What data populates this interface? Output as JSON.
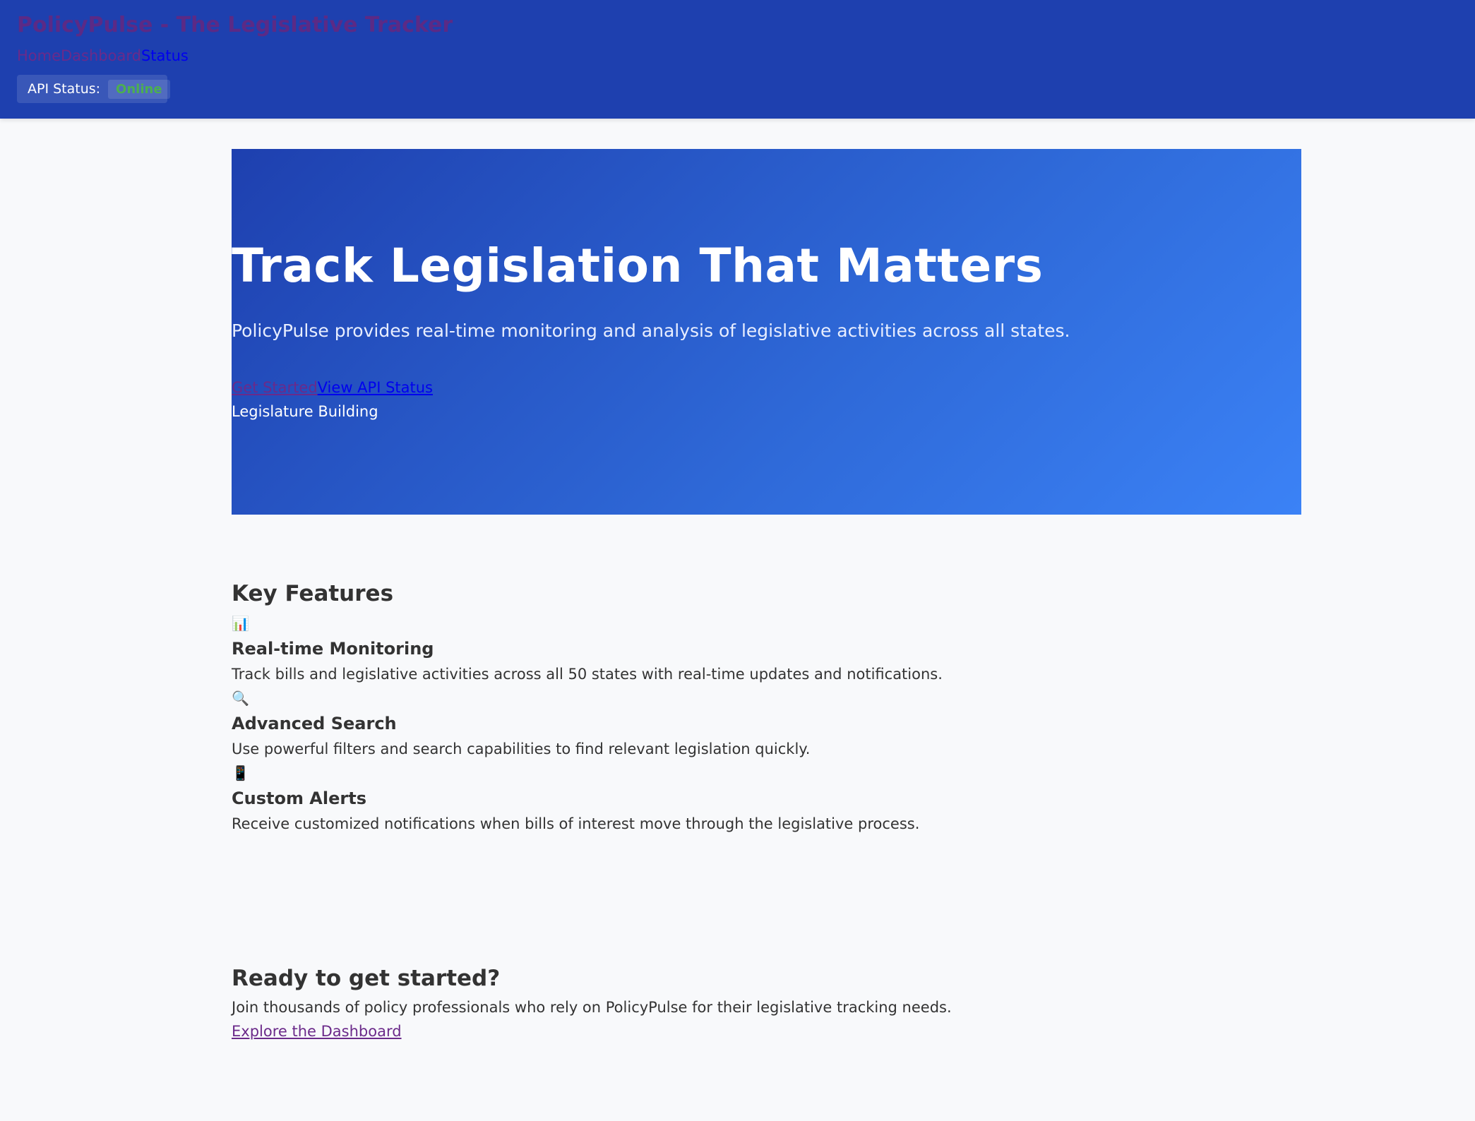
{
  "header": {
    "site_title": "PolicyPulse - The Legislative Tracker",
    "nav": {
      "home": "Home",
      "dashboard": "Dashboard",
      "status": "Status"
    },
    "api_status": {
      "label": "API Status:",
      "value": "Online",
      "value_color": "#4caf50"
    }
  },
  "hero": {
    "title": "Track Legislation That Matters",
    "subtitle": "PolicyPulse provides real-time monitoring and analysis of legislative activities across all states.",
    "primary_link": "Get Started",
    "secondary_link": "View API Status",
    "image_alt": "Legislature Building",
    "gradient_start": "#1e40af",
    "gradient_end": "#3b82f6"
  },
  "features": {
    "title": "Key Features",
    "items": [
      {
        "icon": "📊",
        "icon_name": "bar-chart-icon",
        "title": "Real-time Monitoring",
        "description": "Track bills and legislative activities across all 50 states with real-time updates and notifications."
      },
      {
        "icon": "🔍",
        "icon_name": "magnifier-icon",
        "title": "Advanced Search",
        "description": "Use powerful filters and search capabilities to find relevant legislation quickly."
      },
      {
        "icon": "📱",
        "icon_name": "mobile-phone-icon",
        "title": "Custom Alerts",
        "description": "Receive customized notifications when bills of interest move through the legislative process."
      }
    ]
  },
  "cta": {
    "title": "Ready to get started?",
    "text": "Join thousands of policy professionals who rely on PolicyPulse for their legislative tracking needs.",
    "link": "Explore the Dashboard"
  },
  "colors": {
    "header_bg": "#1e40af",
    "page_bg": "#f8f9fb",
    "visited_link": "#6b2a8a",
    "link": "#0000ee"
  }
}
